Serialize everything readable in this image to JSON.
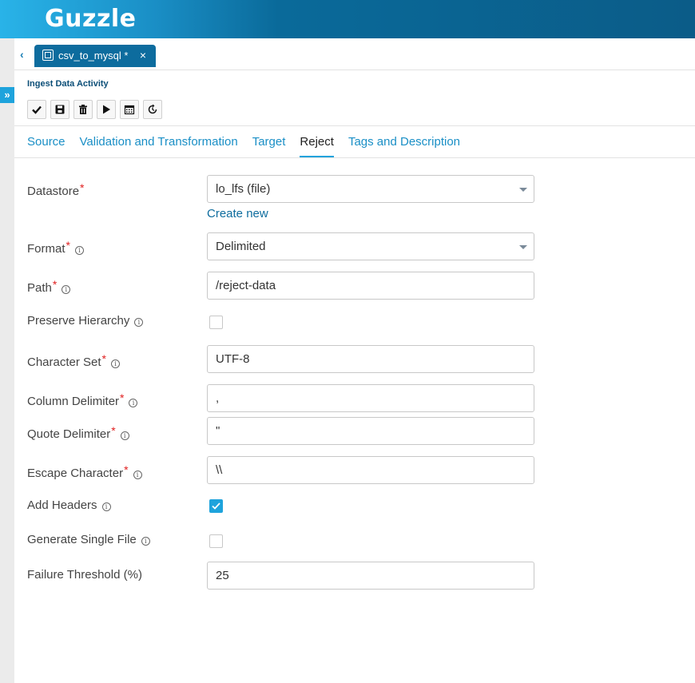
{
  "app": {
    "logo": "Guzzle"
  },
  "left_rail": {
    "expand_icon": "double-chevron-right-icon",
    "expand_glyph": "»"
  },
  "doc_tab": {
    "back_icon": "chevron-left-icon",
    "back_glyph": "‹",
    "label": "csv_to_mysql *",
    "close_glyph": "×"
  },
  "activity": {
    "title": "Ingest Data Activity"
  },
  "toolbar": {
    "buttons": [
      {
        "icon": "check-icon"
      },
      {
        "icon": "save-icon"
      },
      {
        "icon": "trash-icon"
      },
      {
        "icon": "play-icon"
      },
      {
        "icon": "calendar-icon"
      },
      {
        "icon": "history-icon"
      }
    ]
  },
  "tabs": {
    "source": "Source",
    "validation": "Validation and Transformation",
    "target": "Target",
    "reject": "Reject",
    "tags": "Tags and Description",
    "active": "Reject"
  },
  "form": {
    "datastore": {
      "label": "Datastore",
      "value": "lo_lfs (file)",
      "create_link": "Create new"
    },
    "format": {
      "label": "Format",
      "value": "Delimited"
    },
    "path": {
      "label": "Path",
      "value": "/reject-data"
    },
    "preserve_hierarchy": {
      "label": "Preserve Hierarchy",
      "checked": false
    },
    "character_set": {
      "label": "Character Set",
      "value": "UTF-8"
    },
    "column_delimiter": {
      "label": "Column Delimiter",
      "value": ","
    },
    "quote_delimiter": {
      "label": "Quote Delimiter",
      "value": "\""
    },
    "escape_character": {
      "label": "Escape Character",
      "value": "\\\\"
    },
    "add_headers": {
      "label": "Add Headers",
      "checked": true
    },
    "generate_single_file": {
      "label": "Generate Single File",
      "checked": false
    },
    "failure_threshold": {
      "label": "Failure Threshold (%)",
      "value": "25"
    }
  },
  "colors": {
    "brand_dark": "#0b5c88",
    "brand_light": "#29b3e8",
    "accent": "#1ea3dc",
    "required": "#e02020"
  }
}
